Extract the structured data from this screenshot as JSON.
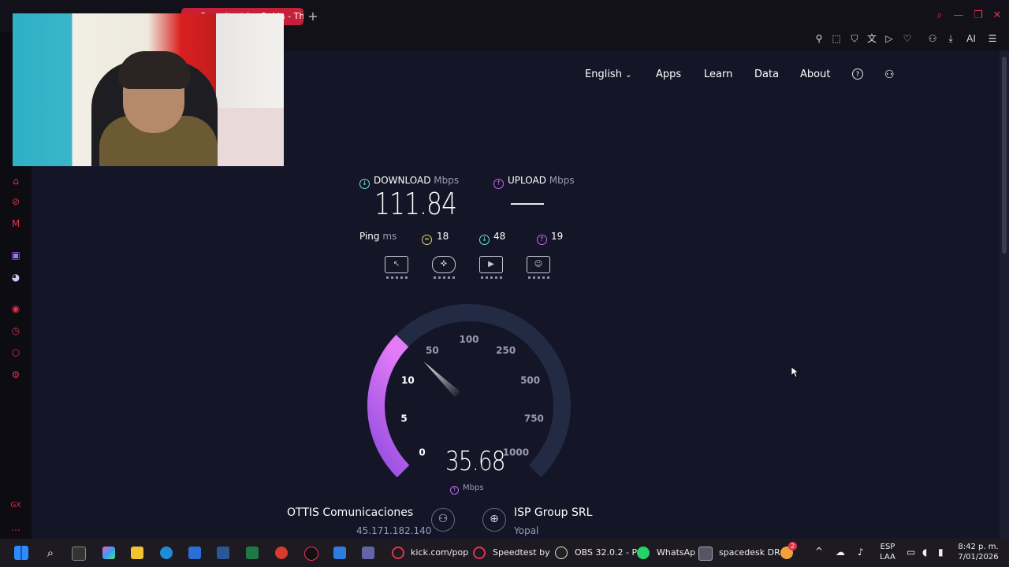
{
  "browser": {
    "active_tab_title": "Speedtest by Ookla - The",
    "toolbar_ai_label": "AI"
  },
  "nav": {
    "language": "English",
    "apps": "Apps",
    "learn": "Learn",
    "data": "Data",
    "about": "About"
  },
  "speed": {
    "download_label": "DOWNLOAD",
    "upload_label": "UPLOAD",
    "unit": "Mbps",
    "download_value": "111.84",
    "upload_value": "",
    "ping_label": "Ping",
    "ping_unit": "ms",
    "ping_idle": "18",
    "ping_down": "48",
    "ping_up": "19"
  },
  "gauge": {
    "current_value": "35.68",
    "unit": "Mbps",
    "ticks": [
      "0",
      "5",
      "10",
      "50",
      "100",
      "250",
      "500",
      "750",
      "1000"
    ],
    "progress_mbps": 35.68
  },
  "server": {
    "isp_name": "OTTIS Comunicaciones",
    "ip": "45.171.182.140",
    "host_name": "ISP Group SRL",
    "host_location": "Yopal"
  },
  "taskbar": {
    "kick_label": "kick.com/pop",
    "speedtest_label": "Speedtest by",
    "obs_label": "OBS 32.0.2 - P",
    "whatsapp_label": "WhatsAp",
    "spacedesk_label": "spacedesk DR",
    "lang_top": "ESP",
    "lang_bottom": "LAA",
    "time": "8:42 p. m.",
    "date": "7/01/2026",
    "badge": "2"
  },
  "colors": {
    "accent_red": "#c5203a",
    "download_teal": "#6fe3e0",
    "upload_purple": "#c26bf2",
    "ping_yellow": "#e7d36a",
    "background": "#141526"
  }
}
